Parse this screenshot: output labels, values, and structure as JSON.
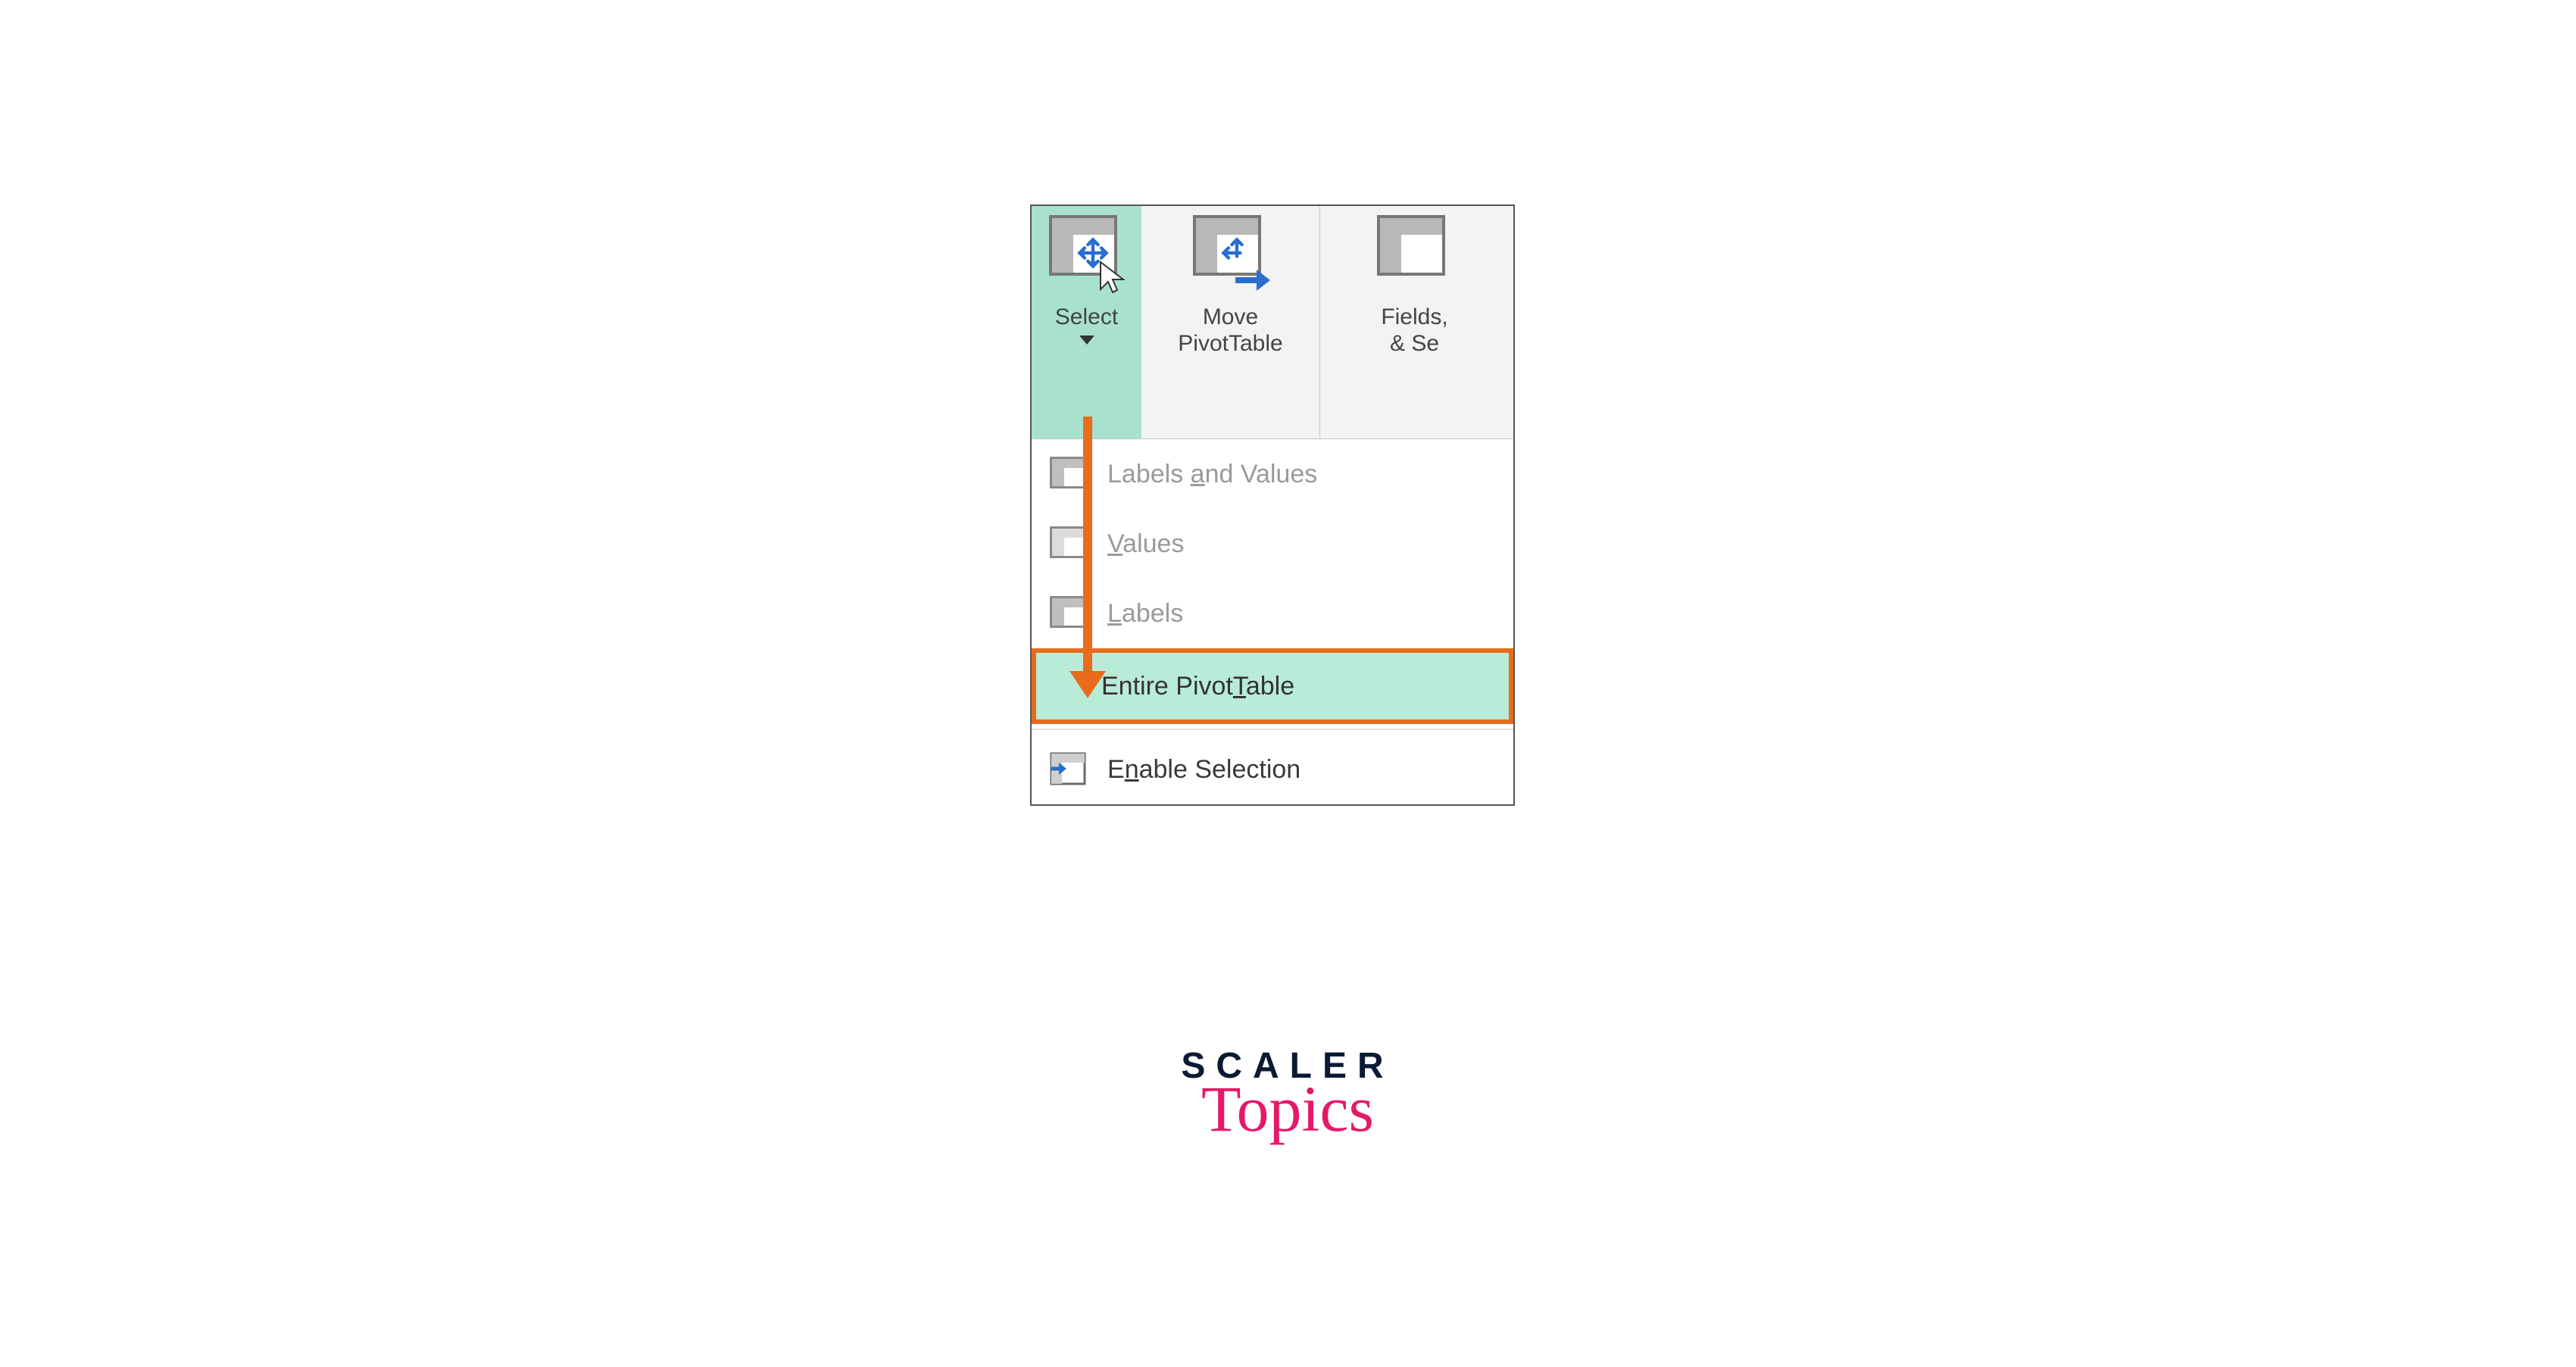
{
  "ribbon": {
    "select": {
      "label": "Select"
    },
    "move": {
      "label": "Move\nPivotTable"
    },
    "fields": {
      "label": "Fields,\n& Se"
    }
  },
  "menu": {
    "labels_and_values": {
      "prefix": "Labels ",
      "u": "a",
      "suffix": "nd Values"
    },
    "values": {
      "u": "V",
      "suffix": "alues"
    },
    "labels": {
      "u": "L",
      "suffix": "abels"
    },
    "entire_pivot": {
      "prefix": "Entire Pivot",
      "u": "T",
      "suffix": "able"
    },
    "enable_selection": {
      "prefix": "E",
      "u": "n",
      "suffix": "able Selection"
    }
  },
  "brand": {
    "line1": "SCALER",
    "line2": "Topics"
  },
  "colors": {
    "selected_bg": "#a8e2cf",
    "highlight_border": "#e86c1a",
    "highlight_bg": "#b9ebd9",
    "brand_pink": "#e51968",
    "brand_dark": "#0a1a33"
  }
}
